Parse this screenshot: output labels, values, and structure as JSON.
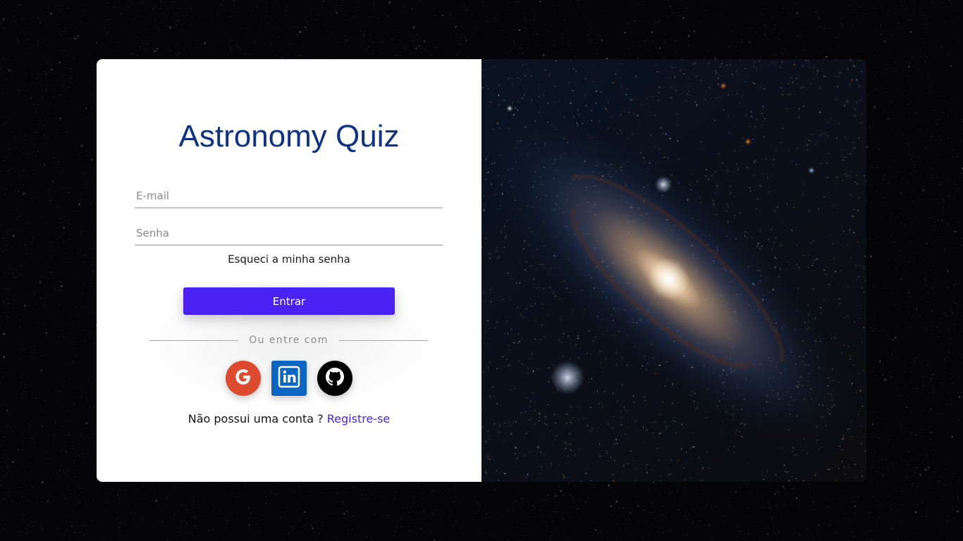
{
  "app": {
    "title": "Astronomy Quiz"
  },
  "form": {
    "email_placeholder": "E-mail",
    "password_placeholder": "Senha",
    "forgot_label": "Esqueci a minha senha",
    "login_label": "Entrar",
    "divider_label": "Ou entre com",
    "signup_question": "Não possui uma conta ?",
    "signup_link": "Registre-se"
  },
  "social": {
    "providers": [
      "google-icon",
      "linkedin-icon",
      "github-icon"
    ]
  },
  "colors": {
    "title": "#0d3386",
    "accent": "#4b22f4",
    "google": "#dd4b2f",
    "linkedin": "#0a66c2",
    "github": "#000000"
  }
}
